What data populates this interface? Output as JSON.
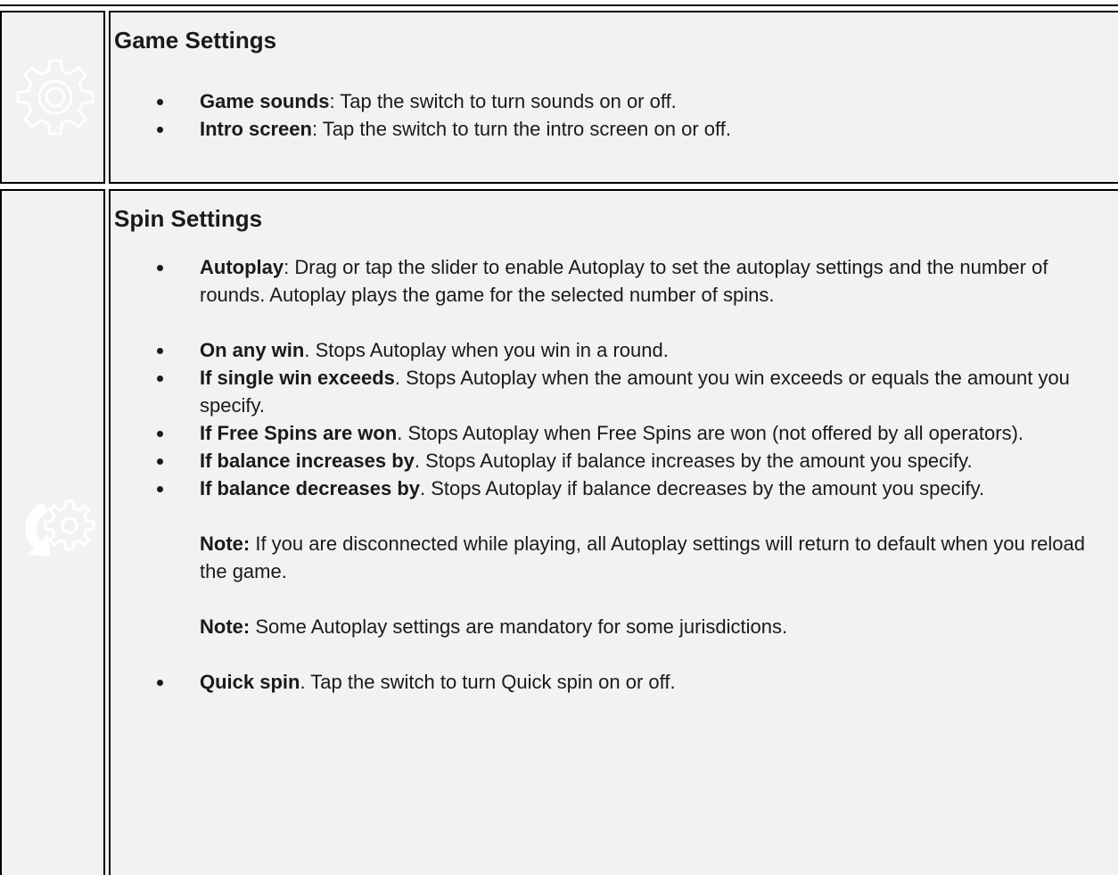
{
  "sections": {
    "game": {
      "title": "Game Settings",
      "icon": "gear-icon",
      "items": [
        {
          "bold": "Game sounds",
          "text": ": Tap the switch to turn sounds on or off."
        },
        {
          "bold": "Intro screen",
          "text": ": Tap the switch to turn the intro screen on or off."
        }
      ]
    },
    "spin": {
      "title": "Spin Settings",
      "icon": "autoplay-gear-icon",
      "autoplay": {
        "bold": "Autoplay",
        "text": ": Drag or tap the slider to enable Autoplay to set the autoplay settings and the number of rounds. Autoplay plays the game for the selected number of spins."
      },
      "items": [
        {
          "bold": "On any win",
          "text": ". Stops Autoplay when you win in a round."
        },
        {
          "bold": "If single win exceeds",
          "text": ". Stops Autoplay when the amount you win exceeds or equals the amount you specify."
        },
        {
          "bold": "If Free Spins are won",
          "text": ". Stops Autoplay when Free Spins are won (not offered by all operators)."
        },
        {
          "bold": "If balance increases by",
          "text": ". Stops Autoplay if balance increases by the amount you specify."
        },
        {
          "bold": "If balance decreases by",
          "text": ". Stops Autoplay if balance decreases by the amount you specify."
        }
      ],
      "notes": [
        {
          "bold": "Note:",
          "text": " If you are disconnected while playing, all Autoplay settings will return to default when you reload the game."
        },
        {
          "bold": "Note:",
          "text": " Some Autoplay settings are mandatory for some jurisdictions."
        }
      ],
      "quick_spin": {
        "bold": "Quick spin",
        "text": ". Tap the switch to turn Quick spin on or off."
      }
    }
  },
  "colors": {
    "background": "#f2f2f2",
    "icon": "#ffffff",
    "border": "#000000"
  }
}
